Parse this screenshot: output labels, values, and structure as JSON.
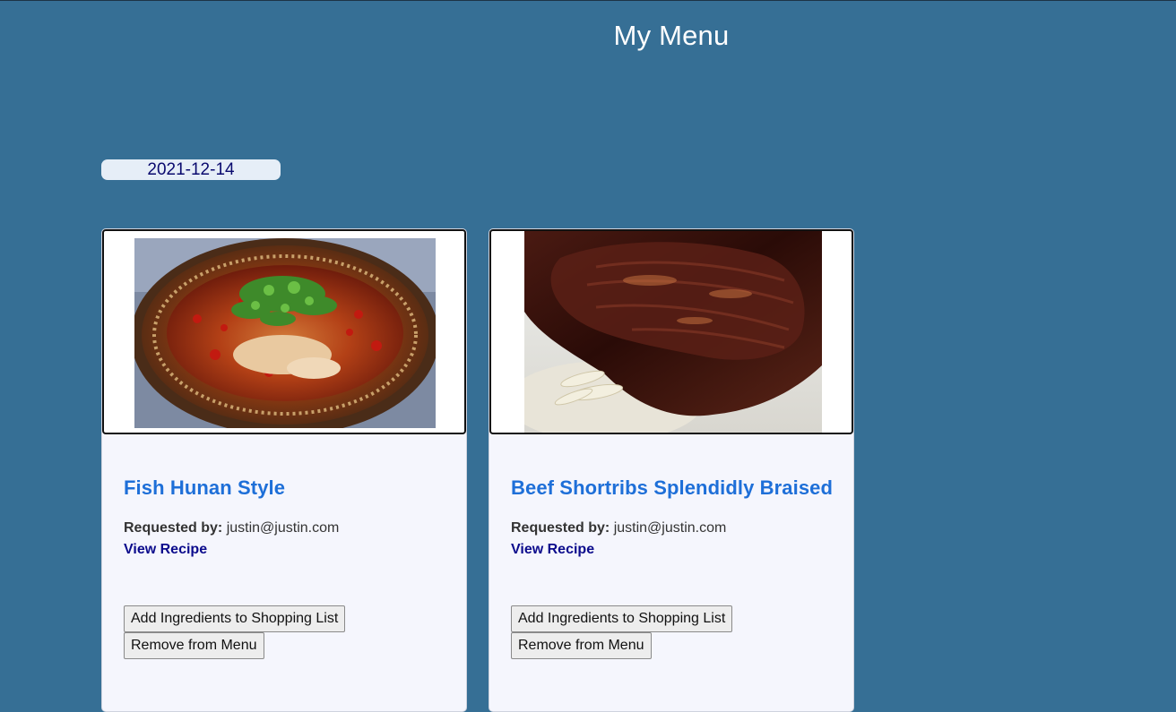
{
  "header": {
    "title": "My Menu"
  },
  "date": {
    "value": "2021-12-14"
  },
  "menu_items": [
    {
      "title": "Fish Hunan Style",
      "image_alt": "fish-hunan-style-photo",
      "requested_label": "Requested by:",
      "requested_by": "justin@justin.com",
      "view_recipe_label": "View Recipe",
      "add_ingredients_label": "Add Ingredients to Shopping List",
      "remove_label": "Remove from Menu"
    },
    {
      "title": "Beef Shortribs Splendidly Braised",
      "image_alt": "beef-shortribs-photo",
      "requested_label": "Requested by:",
      "requested_by": "justin@justin.com",
      "view_recipe_label": "View Recipe",
      "add_ingredients_label": "Add Ingredients to Shopping List",
      "remove_label": "Remove from Menu"
    }
  ],
  "colors": {
    "background": "#366f95",
    "card": "#f5f6fd",
    "title_link": "#1e6fd8",
    "view_link": "#0b0b8c",
    "date_pill": "#e6eef7"
  }
}
